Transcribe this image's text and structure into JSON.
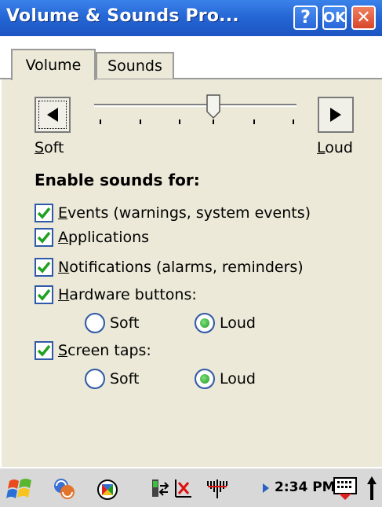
{
  "window": {
    "title": "Volume & Sounds Pro...",
    "help_label": "?",
    "ok_label": "OK",
    "close_label": "✕"
  },
  "tabs": [
    {
      "label": "Volume",
      "selected": true
    },
    {
      "label": "Sounds",
      "selected": false
    }
  ],
  "volume": {
    "soft_prefix": "S",
    "soft_rest": "oft",
    "loud_prefix": "L",
    "loud_rest": "oud",
    "level": 0.5
  },
  "enable": {
    "heading": "Enable sounds for:",
    "items": [
      {
        "hot": "E",
        "rest": "vents (warnings, system events)",
        "checked": true
      },
      {
        "hot": "A",
        "rest": "pplications",
        "checked": true
      },
      {
        "hot": "N",
        "rest": "otifications (alarms, reminders)",
        "checked": true
      },
      {
        "hot": "H",
        "rest": "ardware buttons:",
        "checked": true
      },
      {
        "hot": "S",
        "rest": "creen taps:",
        "checked": true
      }
    ],
    "hardware_radios": {
      "soft": "Soft",
      "loud": "Loud",
      "selected": "Loud"
    },
    "screen_radios": {
      "soft": "Soft",
      "loud": "Loud",
      "selected": "Loud"
    }
  },
  "taskbar": {
    "time": "2:34 PM"
  },
  "colors": {
    "titlebar": "#2465d4",
    "panel": "#ece9d8",
    "checkbox_border": "#2f5aa8",
    "check_mark": "#21a121",
    "radio_dot": "#1e9a1e"
  }
}
